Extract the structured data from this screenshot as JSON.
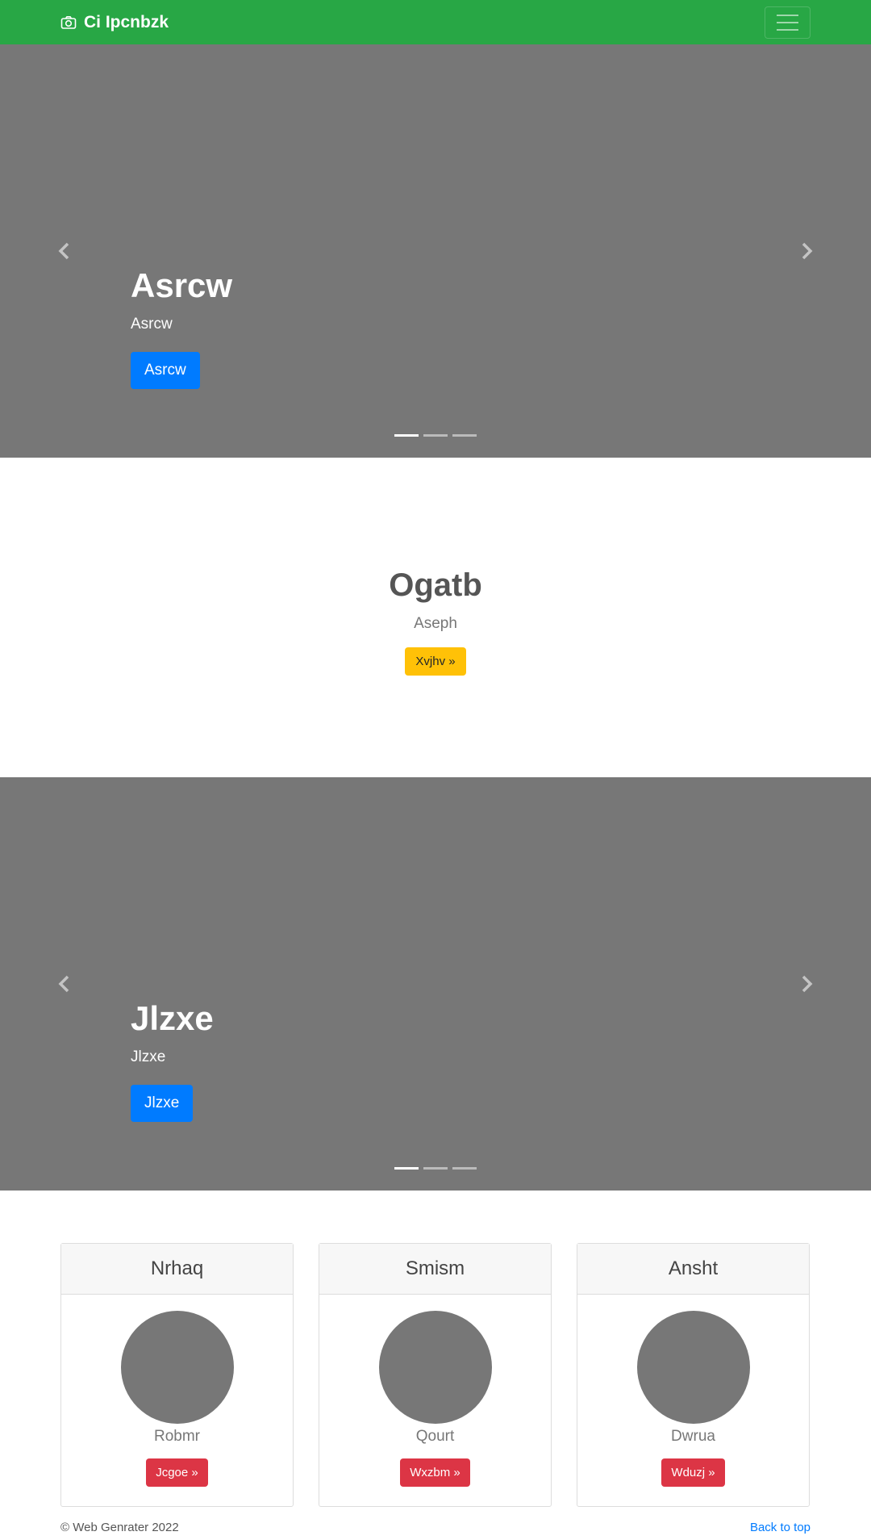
{
  "navbar": {
    "brand": "Ci Ipcnbzk",
    "brand_icon": "camera-icon",
    "toggler_icon": "hamburger-icon",
    "background": "#28a745"
  },
  "carousel1": {
    "title": "Asrcw",
    "subtitle": "Asrcw",
    "button": "Asrcw",
    "slides": 3,
    "active_slide": 1
  },
  "feature": {
    "title": "Ogatb",
    "text": "Aseph",
    "button": "Xvjhv »"
  },
  "carousel2": {
    "title": "Jlzxe",
    "subtitle": "Jlzxe",
    "button": "Jlzxe",
    "slides": 3,
    "active_slide": 1
  },
  "cards": [
    {
      "header": "Nrhaq",
      "text": "Robmr",
      "button": "Jcgoe »"
    },
    {
      "header": "Smism",
      "text": "Qourt",
      "button": "Wxzbm »"
    },
    {
      "header": "Ansht",
      "text": "Dwrua",
      "button": "Wduzj »"
    }
  ],
  "footer": {
    "copyright": "© Web Genrater 2022",
    "back_to_top": "Back to top"
  },
  "colors": {
    "primary": "#007bff",
    "warning": "#ffc107",
    "danger": "#dc3545",
    "placeholder_gray": "#777777"
  }
}
